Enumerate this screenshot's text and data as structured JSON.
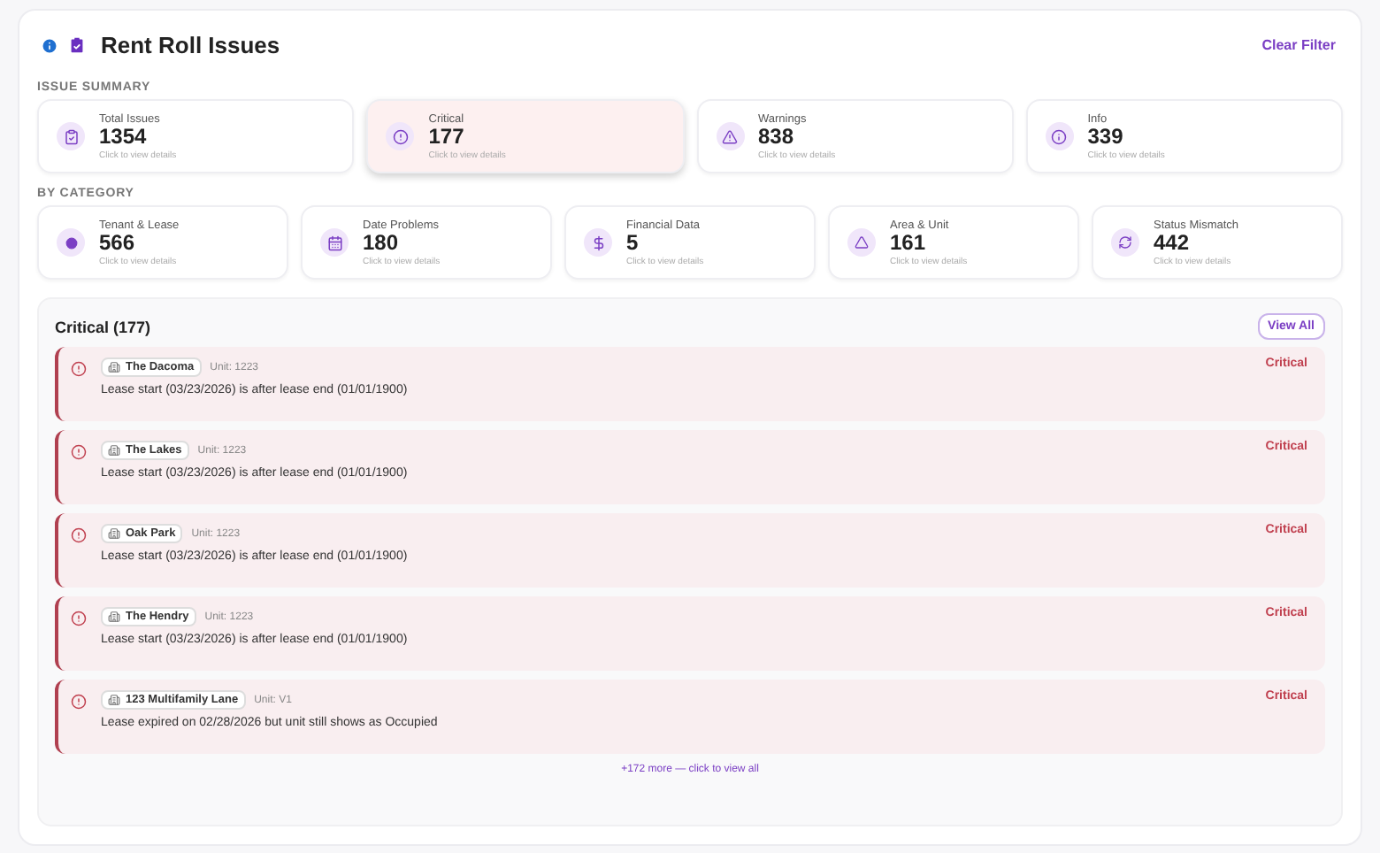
{
  "header": {
    "title": "Rent Roll Issues",
    "clear_filter": "Clear Filter"
  },
  "summary": {
    "label": "ISSUE SUMMARY",
    "cards": [
      {
        "kind": "total",
        "label": "Total Issues",
        "count": "1354",
        "hint": "Click to view details",
        "selected": false
      },
      {
        "kind": "critical",
        "label": "Critical",
        "count": "177",
        "hint": "Click to view details",
        "selected": true
      },
      {
        "kind": "warning",
        "label": "Warnings",
        "count": "838",
        "hint": "Click to view details",
        "selected": false
      },
      {
        "kind": "info",
        "label": "Info",
        "count": "339",
        "hint": "Click to view details",
        "selected": false
      }
    ]
  },
  "categories": {
    "label": "BY CATEGORY",
    "cards": [
      {
        "kind": "tenant",
        "label": "Tenant & Lease",
        "count": "566",
        "hint": "Click to view details"
      },
      {
        "kind": "date",
        "label": "Date Problems",
        "count": "180",
        "hint": "Click to view details"
      },
      {
        "kind": "financial",
        "label": "Financial Data",
        "count": "5",
        "hint": "Click to view details"
      },
      {
        "kind": "area",
        "label": "Area & Unit",
        "count": "161",
        "hint": "Click to view details"
      },
      {
        "kind": "status",
        "label": "Status Mismatch",
        "count": "442",
        "hint": "Click to view details"
      }
    ]
  },
  "issues_panel": {
    "title": "Critical (177)",
    "view_all": "View All",
    "more": "+172 more — click to view all",
    "issues": [
      {
        "property": "The Dacoma",
        "unit": "Unit: 1223",
        "message": "Lease start (03/23/2026) is after lease end (01/01/1900)",
        "severity": "Critical"
      },
      {
        "property": "The Lakes",
        "unit": "Unit: 1223",
        "message": "Lease start (03/23/2026) is after lease end (01/01/1900)",
        "severity": "Critical"
      },
      {
        "property": "Oak Park",
        "unit": "Unit: 1223",
        "message": "Lease start (03/23/2026) is after lease end (01/01/1900)",
        "severity": "Critical"
      },
      {
        "property": "The Hendry",
        "unit": "Unit: 1223",
        "message": "Lease start (03/23/2026) is after lease end (01/01/1900)",
        "severity": "Critical"
      },
      {
        "property": "123 Multifamily Lane",
        "unit": "Unit: V1",
        "message": "Lease expired on 02/28/2026 but unit still shows as Occupied",
        "severity": "Critical"
      }
    ]
  }
}
